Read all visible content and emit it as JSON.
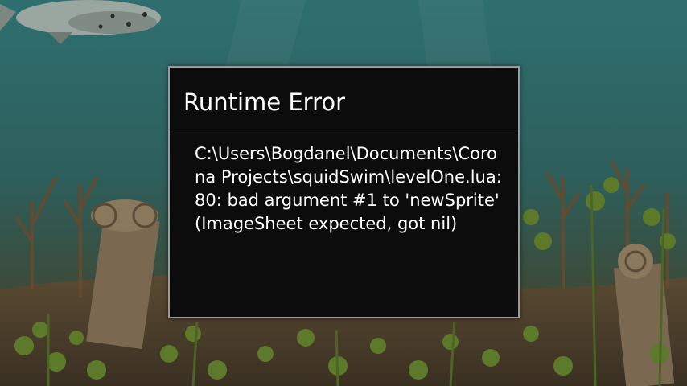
{
  "dialog": {
    "title": "Runtime Error",
    "message": "C:\\Users\\Bogdanel\\Documents\\Corona Projects\\squidSwim\\levelOne.lua:80: bad argument #1 to 'newSprite' (ImageSheet expected, got nil)"
  },
  "colors": {
    "water_top": "#2c6a6a",
    "water_bottom": "#3b4a3a",
    "seabed": "#4a3f2e",
    "dialog_bg": "#0c0c0c",
    "dialog_border": "#9a9a9a"
  }
}
